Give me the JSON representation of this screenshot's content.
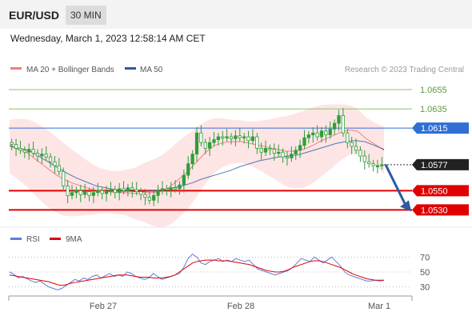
{
  "header": {
    "symbol": "EUR/USD",
    "timeframe": "30 MIN",
    "datetime": "Wednesday, March 1, 2023 12:58:14 AM CET"
  },
  "legend": {
    "ma20_label": "MA 20 + Bollinger Bands",
    "ma50_label": "MA 50",
    "credit": "Research © 2023 Trading Central",
    "rsi_label": "RSI",
    "rsi_ma_label": "9MA"
  },
  "colors": {
    "ma20": "#f08080",
    "ma50": "#2c5aa0",
    "band_fill": "#fde0e0",
    "resistance_line": "#8cc46a",
    "pivot_line": "#2f6fd6",
    "support_line": "#e00000",
    "candle": "#2e9e3a",
    "last_price_tag": "#222222",
    "arrow": "#2c5aa0",
    "rsi": "#5b7fd6",
    "rsi_ma": "#e00000"
  },
  "chart_data": [
    {
      "type": "candlestick",
      "x_ticks": [
        "Feb 27",
        "Feb 28",
        "Mar 1"
      ],
      "ylim": [
        1.0522,
        1.0665
      ],
      "levels": [
        {
          "value": 1.0655,
          "label": "1.0655",
          "kind": "resistance"
        },
        {
          "value": 1.0635,
          "label": "1.0635",
          "kind": "resistance"
        },
        {
          "value": 1.0615,
          "label": "1.0615",
          "kind": "pivot"
        },
        {
          "value": 1.055,
          "label": "1.0550",
          "kind": "support"
        },
        {
          "value": 1.053,
          "label": "1.0530",
          "kind": "support"
        }
      ],
      "last_price": {
        "value": 1.0577,
        "label": "1.0577"
      },
      "forecast_arrow": {
        "from": 1.0577,
        "to": 1.053,
        "direction": "down"
      },
      "close": [
        1.0598,
        1.0594,
        1.0592,
        1.059,
        1.0593,
        1.0589,
        1.0586,
        1.0588,
        1.0585,
        1.058,
        1.0576,
        1.057,
        1.0555,
        1.0545,
        1.0548,
        1.055,
        1.0546,
        1.0549,
        1.0545,
        1.0548,
        1.055,
        1.0547,
        1.0549,
        1.0551,
        1.0548,
        1.0552,
        1.055,
        1.0553,
        1.0551,
        1.0549,
        1.0546,
        1.0543,
        1.054,
        1.0545,
        1.055,
        1.0552,
        1.0551,
        1.0553,
        1.0552,
        1.0556,
        1.0566,
        1.0578,
        1.0588,
        1.061,
        1.06,
        1.0594,
        1.06,
        1.0603,
        1.0606,
        1.0605,
        1.0606,
        1.0604,
        1.0607,
        1.0605,
        1.0606,
        1.0602,
        1.0606,
        1.0594,
        1.059,
        1.0594,
        1.0593,
        1.0589,
        1.059,
        1.0585,
        1.0584,
        1.0588,
        1.0592,
        1.0597,
        1.0605,
        1.0608,
        1.061,
        1.0606,
        1.0612,
        1.0608,
        1.0614,
        1.062,
        1.0628,
        1.061,
        1.06,
        1.0596,
        1.0592,
        1.0586,
        1.058,
        1.0578,
        1.0576,
        1.0576,
        1.0577
      ],
      "ma20": [
        1.0596,
        1.0593,
        1.0589,
        1.0582,
        1.0575,
        1.0568,
        1.0562,
        1.0558,
        1.0555,
        1.0552,
        1.055,
        1.0549,
        1.0548,
        1.0548,
        1.0547,
        1.0548,
        1.0548,
        1.0549,
        1.0554,
        1.0562,
        1.057,
        1.058,
        1.059,
        1.0597,
        1.06,
        1.0601,
        1.0601,
        1.0599,
        1.0597,
        1.0595,
        1.0593,
        1.0591,
        1.0591,
        1.0593,
        1.0597,
        1.0602,
        1.0606,
        1.061,
        1.0613,
        1.0612,
        1.0604,
        1.0598,
        1.0592
      ],
      "ma50": [
        1.0597,
        1.0594,
        1.0592,
        1.0586,
        1.058,
        1.0574,
        1.0568,
        1.0563,
        1.0559,
        1.0555,
        1.0553,
        1.0551,
        1.055,
        1.0549,
        1.0549,
        1.055,
        1.0551,
        1.0553,
        1.0555,
        1.0558,
        1.0562,
        1.0565,
        1.0568,
        1.0571,
        1.0575,
        1.0578,
        1.0581,
        1.0583,
        1.0585,
        1.0586,
        1.0587,
        1.059,
        1.0593,
        1.0596,
        1.0599,
        1.0601,
        1.0602,
        1.0601,
        1.0597,
        1.0593
      ]
    },
    {
      "type": "line",
      "name": "RSI",
      "y_ticks": [
        30,
        50,
        70
      ],
      "ylim": [
        20,
        80
      ],
      "rsi": [
        50,
        47,
        42,
        44,
        41,
        38,
        36,
        38,
        34,
        30,
        28,
        26,
        28,
        32,
        36,
        40,
        38,
        42,
        40,
        44,
        46,
        42,
        45,
        48,
        44,
        46,
        44,
        50,
        48,
        44,
        42,
        40,
        42,
        48,
        44,
        40,
        42,
        44,
        46,
        48,
        56,
        68,
        74,
        70,
        62,
        60,
        64,
        66,
        68,
        64,
        66,
        64,
        68,
        66,
        64,
        66,
        60,
        54,
        52,
        50,
        48,
        46,
        48,
        50,
        52,
        56,
        62,
        68,
        66,
        64,
        70,
        66,
        62,
        66,
        70,
        64,
        58,
        50,
        46,
        44,
        42,
        40,
        38,
        38,
        39,
        38,
        39
      ],
      "rsi_ma": [
        46,
        45,
        44,
        43,
        42,
        41,
        40,
        39,
        38,
        37,
        35,
        33,
        32,
        33,
        35,
        36,
        37,
        38,
        39,
        40,
        41,
        42,
        43,
        44,
        45,
        46,
        46,
        46,
        45,
        44,
        43,
        43,
        43,
        42,
        42,
        42,
        43,
        44,
        46,
        50,
        54,
        58,
        62,
        64,
        65,
        66,
        66,
        66,
        65,
        65,
        65,
        64,
        63,
        62,
        61,
        60,
        58,
        56,
        54,
        52,
        51,
        50,
        50,
        51,
        53,
        56,
        58,
        60,
        62,
        64,
        65,
        65,
        64,
        62,
        60,
        58,
        56,
        53,
        50,
        47,
        45,
        43,
        41,
        40,
        39,
        39,
        39
      ]
    }
  ]
}
